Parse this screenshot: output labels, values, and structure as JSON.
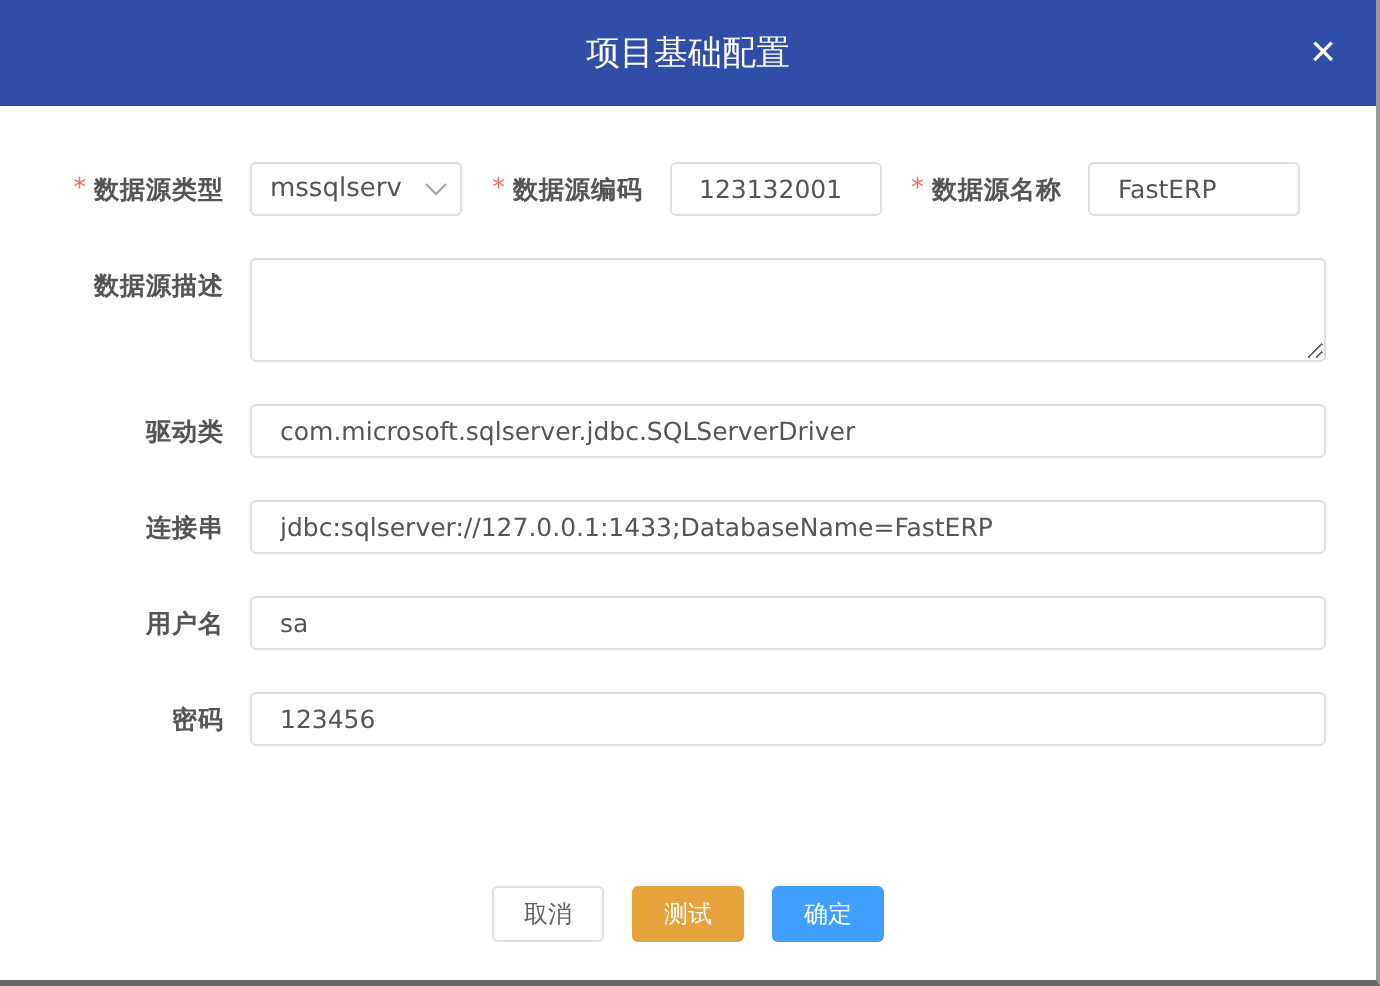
{
  "dialog": {
    "title": "项目基础配置",
    "close": "×"
  },
  "top_row": [
    {
      "label": "数据源类型",
      "required": true,
      "kind": "select",
      "value": "mssqlserv"
    },
    {
      "label": "数据源编码",
      "required": true,
      "kind": "input",
      "value": "123132001"
    },
    {
      "label": "数据源名称",
      "required": true,
      "kind": "input",
      "value": "FastERP"
    }
  ],
  "required_mark": "*",
  "fields": [
    {
      "label": "数据源描述",
      "kind": "textarea"
    },
    {
      "label": "驱动类",
      "kind": "input",
      "value": "com.microsoft.sqlserver.jdbc.SQLServerDriver"
    },
    {
      "label": "连接串",
      "kind": "input",
      "value": "jdbc:sqlserver://127.0.0.1:1433;DatabaseName=FastERP"
    },
    {
      "label": "用户名",
      "kind": "input",
      "value": "sa"
    },
    {
      "label": "密码",
      "kind": "input",
      "value": "123456"
    }
  ],
  "buttons": [
    {
      "label": "取消",
      "kind": "default"
    },
    {
      "label": "测试",
      "kind": "warning"
    },
    {
      "label": "确定",
      "kind": "primary"
    }
  ]
}
